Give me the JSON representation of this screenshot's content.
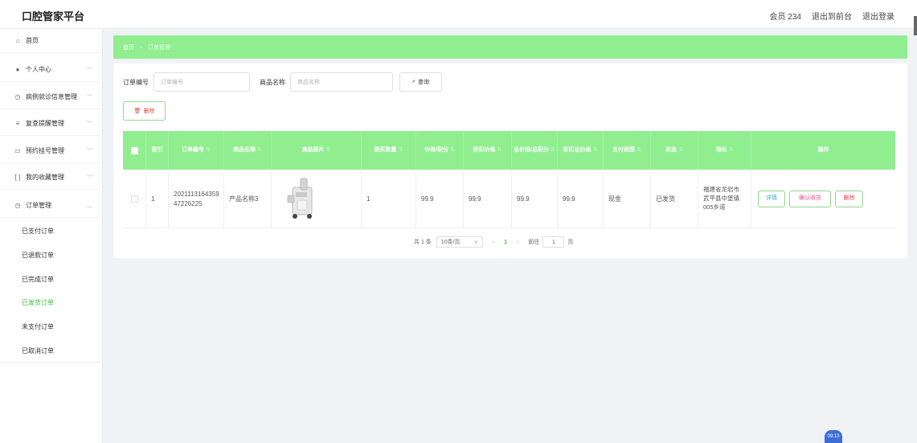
{
  "app": {
    "title": "口腔管家平台"
  },
  "header": {
    "links": [
      "会员 234",
      "退出到前台",
      "退出登录"
    ]
  },
  "sidebar": {
    "items": [
      {
        "label": "首页",
        "icon": "home-icon"
      },
      {
        "label": "个人中心",
        "icon": "user-icon"
      },
      {
        "label": "病例就诊信息管理",
        "icon": "clock-icon"
      },
      {
        "label": "复查提醒管理",
        "icon": "list-icon"
      },
      {
        "label": "预约挂号管理",
        "icon": "chat-icon"
      },
      {
        "label": "我的收藏管理",
        "icon": "bracket-icon"
      },
      {
        "label": "订单管理",
        "icon": "clock-icon"
      }
    ],
    "sub_items": [
      "已支付订单",
      "已退款订单",
      "已完成订单",
      "已发货订单",
      "未支付订单",
      "已取消订单"
    ],
    "active_sub": "已发货订单"
  },
  "breadcrumb": {
    "home": "首页",
    "separator": "→",
    "current": "订单管理"
  },
  "search": {
    "order_label": "订单编号",
    "order_placeholder": "订单编号",
    "product_label": "商品名称",
    "product_placeholder": "商品名称",
    "button_label": "查询"
  },
  "toolbar": {
    "delete_label": "删除"
  },
  "table": {
    "headers": [
      "索引",
      "订单编号",
      "商品名称",
      "商品图片",
      "购买数量",
      "价格/积分",
      "折扣价格",
      "总价格/总积分",
      "折扣总价格",
      "支付类型",
      "状态",
      "地址",
      "操作"
    ],
    "rows": [
      {
        "index": "1",
        "order_no": "202111316435947226225",
        "product_name": "产品名称3",
        "quantity": "1",
        "price": "99.9",
        "discount_price": "99.9",
        "total": "99.9",
        "discount_total": "99.9",
        "pay_type": "现金",
        "status": "已发货",
        "address": "福建省龙岩市武平县中堡镇005乡道",
        "actions": [
          "详情",
          "确认收货",
          "删除"
        ]
      }
    ]
  },
  "pagination": {
    "total_text": "共 1 条",
    "page_size": "10条/页",
    "current_page": "1",
    "goto_label": "前往",
    "goto_value": "1",
    "page_suffix": "页"
  },
  "overlay": {
    "timer": "09:13"
  }
}
